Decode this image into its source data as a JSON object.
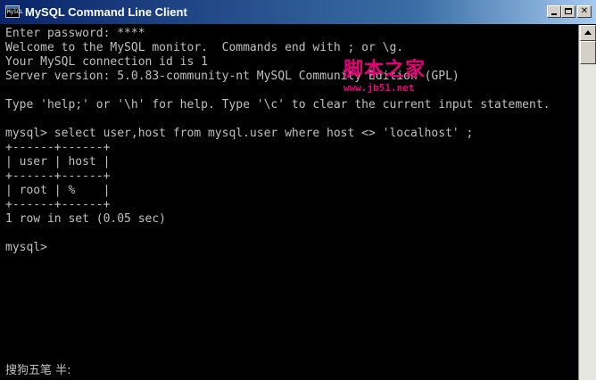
{
  "window": {
    "title": "MySQL Command Line Client",
    "icon_label": "MySQL"
  },
  "console": {
    "lines": [
      "Enter password: ****",
      "Welcome to the MySQL monitor.  Commands end with ; or \\g.",
      "Your MySQL connection id is 1",
      "Server version: 5.0.83-community-nt MySQL Community Edition (GPL)",
      "",
      "Type 'help;' or '\\h' for help. Type '\\c' to clear the current input statement.",
      "",
      "mysql> select user,host from mysql.user where host <> 'localhost' ;",
      "+------+------+",
      "| user | host |",
      "+------+------+",
      "| root | %    |",
      "+------+------+",
      "1 row in set (0.05 sec)",
      "",
      "mysql>"
    ]
  },
  "watermark": {
    "text": "脚本之家",
    "url": "www.jb51.net"
  },
  "ime": {
    "status": "搜狗五笔 半:"
  },
  "colors": {
    "console_bg": "#000000",
    "console_text": "#c0c0c0",
    "watermark": "#e8007a",
    "title_start": "#0a246a",
    "title_end": "#a6caf0"
  },
  "icons": {
    "app": "console-icon",
    "minimize": "minimize-icon",
    "maximize": "maximize-icon",
    "close": "close-icon",
    "scroll_up": "arrow-up-icon"
  }
}
